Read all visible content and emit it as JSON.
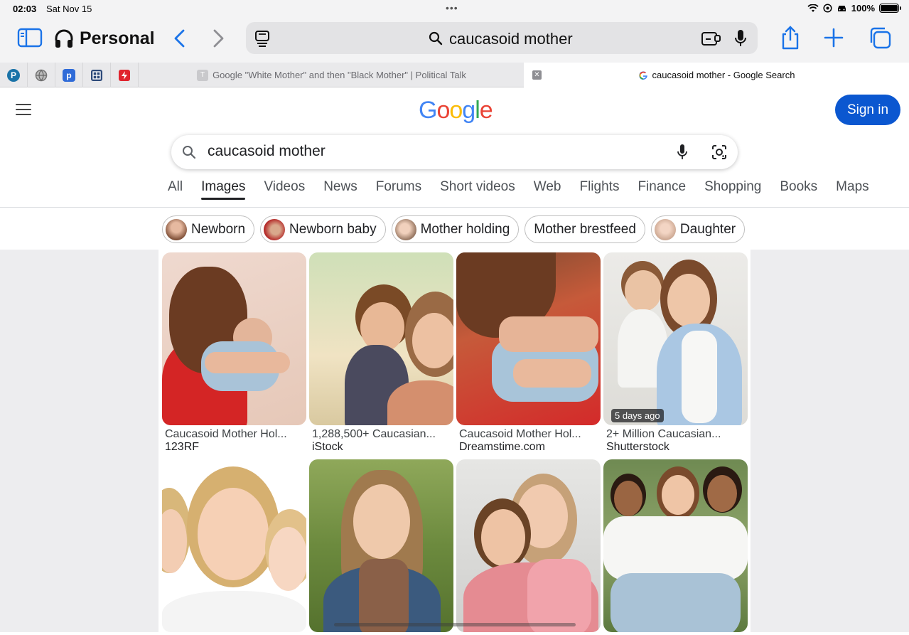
{
  "status": {
    "time": "02:03",
    "date": "Sat Nov 15",
    "battery": "100%"
  },
  "browser": {
    "profile": "Personal",
    "url_text": "caucasoid mother",
    "tabs": [
      {
        "title": "Google \"White Mother\" and then \"Black Mother\" | Political Talk",
        "favicon_letter": "T"
      },
      {
        "title": "caucasoid mother - Google Search"
      }
    ],
    "pinned": [
      {
        "name": "pinned-p-round",
        "letter": "P",
        "color": "#1a73a8"
      },
      {
        "name": "pinned-globe",
        "letter": "",
        "color": "#8a8a8a"
      },
      {
        "name": "pinned-p-square",
        "letter": "p",
        "color": "#2f6bd8"
      },
      {
        "name": "pinned-grid",
        "letter": "",
        "color": "#2d4a7a"
      },
      {
        "name": "pinned-flash",
        "letter": "",
        "color": "#e0242e"
      }
    ]
  },
  "google": {
    "logo": "Google",
    "sign_in": "Sign in",
    "query": "caucasoid mother",
    "tabs": [
      "All",
      "Images",
      "Videos",
      "News",
      "Forums",
      "Short videos",
      "Web",
      "Flights",
      "Finance",
      "Shopping",
      "Books",
      "Maps"
    ],
    "active_tab": "Images",
    "chips": [
      {
        "label": "Newborn",
        "has_image": true
      },
      {
        "label": "Newborn baby",
        "has_image": true
      },
      {
        "label": "Mother holding",
        "has_image": true
      },
      {
        "label": "Mother brestfeed",
        "has_image": false
      },
      {
        "label": "Daughter",
        "has_image": true
      }
    ],
    "results": [
      {
        "title": "Caucasoid Mother Hol...",
        "source": "123RF"
      },
      {
        "title": "1,288,500+ Caucasian...",
        "source": "iStock"
      },
      {
        "title": "Caucasoid Mother Hol...",
        "source": "Dreamstime.com"
      },
      {
        "title": "2+ Million Caucasian...",
        "source": "Shutterstock",
        "badge": "5 days ago"
      },
      {
        "title": "",
        "source": ""
      },
      {
        "title": "",
        "source": ""
      },
      {
        "title": "",
        "source": ""
      },
      {
        "title": "",
        "source": ""
      }
    ]
  },
  "colors": {
    "accent": "#1a73e8",
    "sign_in_bg": "#0b57d0"
  }
}
